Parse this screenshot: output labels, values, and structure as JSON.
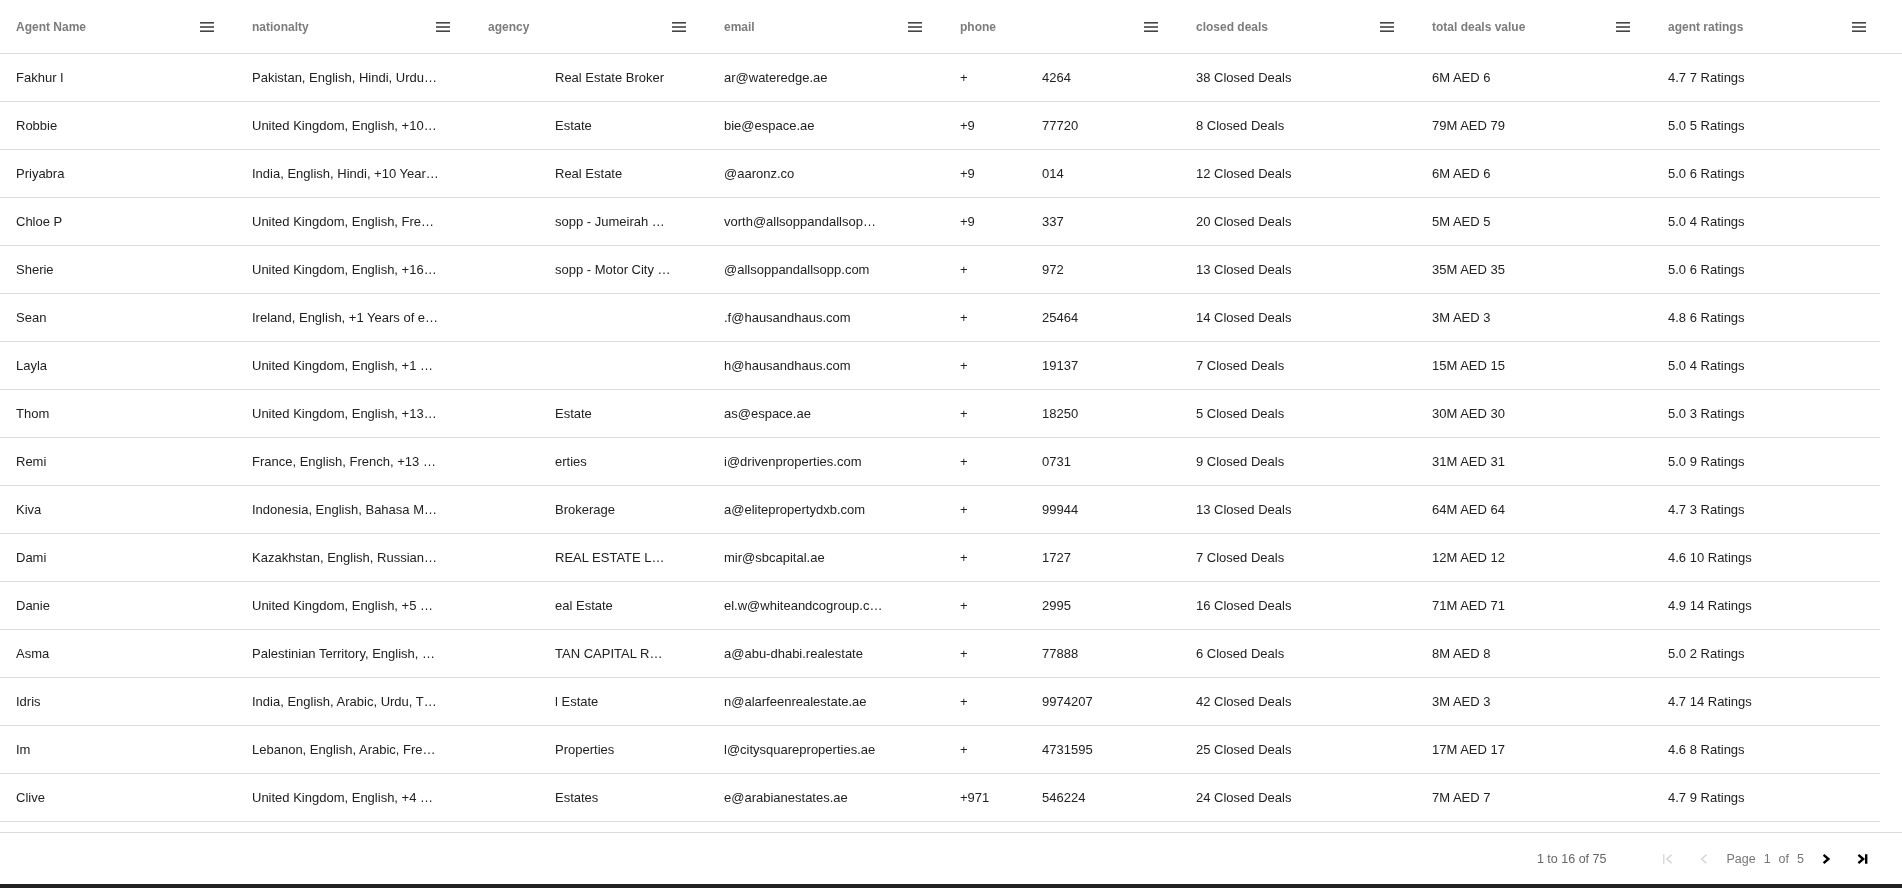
{
  "columns": [
    "Agent Name",
    "nationalty",
    "agency",
    "email",
    "phone",
    "closed deals",
    "total deals value",
    "agent ratings"
  ],
  "rows": [
    {
      "name": "Fakhur I",
      "nationality": "Pakistan, English, Hindi, Urdu…",
      "agency": "Real Estate Broker",
      "email": "ar@wateredge.ae",
      "phone_start": "+",
      "phone_end": "4264",
      "deals": "38 Closed Deals",
      "value": "6M AED 6",
      "rating": "4.7 7 Ratings"
    },
    {
      "name": "Robbie",
      "nationality": "United Kingdom, English, +10…",
      "agency": "Estate",
      "email": "bie@espace.ae",
      "phone_start": "+9",
      "phone_end": "77720",
      "deals": "8 Closed Deals",
      "value": "79M AED 79",
      "rating": "5.0 5 Ratings"
    },
    {
      "name": "Priyabra",
      "nationality": "India, English, Hindi, +10 Year…",
      "agency": "Real Estate",
      "email": "@aaronz.co",
      "phone_start": "+9",
      "phone_end": "014",
      "deals": "12 Closed Deals",
      "value": "6M AED 6",
      "rating": "5.0 6 Ratings"
    },
    {
      "name": "Chloe P",
      "nationality": "United Kingdom, English, Fre…",
      "agency": "sopp - Jumeirah …",
      "email": "vorth@allsoppandallsop…",
      "phone_start": "+9",
      "phone_end": "337",
      "deals": "20 Closed Deals",
      "value": "5M AED 5",
      "rating": "5.0 4 Ratings"
    },
    {
      "name": "Sherie",
      "nationality": "United Kingdom, English, +16…",
      "agency": "sopp - Motor City …",
      "email": "@allsoppandallsopp.com",
      "phone_start": "+",
      "phone_end": "972",
      "deals": "13 Closed Deals",
      "value": "35M AED 35",
      "rating": "5.0 6 Ratings"
    },
    {
      "name": "Sean",
      "nationality": "Ireland, English, +1 Years of e…",
      "email": ".f@hausandhaus.com",
      "phone_start": "+",
      "phone_end": "25464",
      "deals": "14 Closed Deals",
      "value": "3M AED 3",
      "rating": "4.8 6 Ratings"
    },
    {
      "name": "Layla",
      "nationality": "United Kingdom, English, +1 …",
      "email": "h@hausandhaus.com",
      "phone_start": "+",
      "phone_end": "19137",
      "deals": "7 Closed Deals",
      "value": "15M AED 15",
      "rating": "5.0 4 Ratings"
    },
    {
      "name": "Thom",
      "nationality": "United Kingdom, English, +13…",
      "agency": "Estate",
      "email": "as@espace.ae",
      "phone_start": "+",
      "phone_end": "18250",
      "deals": "5 Closed Deals",
      "value": "30M AED 30",
      "rating": "5.0 3 Ratings"
    },
    {
      "name": "Remi",
      "nationality": "France, English, French, +13 …",
      "agency": "erties",
      "email": "i@drivenproperties.com",
      "phone_start": "+",
      "phone_end": "0731",
      "deals": "9 Closed Deals",
      "value": "31M AED 31",
      "rating": "5.0 9 Ratings"
    },
    {
      "name": "Kiva",
      "nationality": "Indonesia, English, Bahasa M…",
      "agency": "Brokerage",
      "email": "a@elitepropertydxb.com",
      "phone_start": "+",
      "phone_end": "99944",
      "deals": "13 Closed Deals",
      "value": "64M AED 64",
      "rating": "4.7 3 Ratings"
    },
    {
      "name": "Dami",
      "nationality": "Kazakhstan, English, Russian…",
      "agency": "REAL ESTATE L…",
      "email": "mir@sbcapital.ae",
      "phone_start": "+",
      "phone_end": "1727",
      "deals": "7 Closed Deals",
      "value": "12M AED 12",
      "rating": "4.6 10 Ratings"
    },
    {
      "name": "Danie",
      "nationality": "United Kingdom, English, +5 …",
      "agency": "eal Estate",
      "email": "el.w@whiteandcogroup.c…",
      "phone_start": "+",
      "phone_end": "2995",
      "deals": "16 Closed Deals",
      "value": "71M AED 71",
      "rating": "4.9 14 Ratings"
    },
    {
      "name": "Asma",
      "nationality": "Palestinian Territory, English, …",
      "agency": "TAN CAPITAL R…",
      "email": "a@abu-dhabi.realestate",
      "phone_start": "+",
      "phone_end": "77888",
      "deals": "6 Closed Deals",
      "value": "8M AED 8",
      "rating": "5.0 2 Ratings"
    },
    {
      "name": "Idris",
      "nationality": "India, English, Arabic, Urdu, T…",
      "agency": "l Estate",
      "email": "n@alarfeenrealestate.ae",
      "phone_start": "+",
      "phone_end": "9974207",
      "deals": "42 Closed Deals",
      "value": "3M AED 3",
      "rating": "4.7 14 Ratings"
    },
    {
      "name": "Im",
      "nationality": "Lebanon, English, Arabic, Fre…",
      "agency": "Properties",
      "email": "l@citysquareproperties.ae",
      "phone_start": "+",
      "phone_end": "4731595",
      "deals": "25 Closed Deals",
      "value": "17M AED 17",
      "rating": "4.6 8 Ratings"
    },
    {
      "name": "Clive",
      "nationality": "United Kingdom, English, +4 …",
      "agency": "Estates",
      "email": "e@arabianestates.ae",
      "phone_start": "+971",
      "phone_end": "546224",
      "deals": "24 Closed Deals",
      "value": "7M AED 7",
      "rating": "4.7 9 Ratings"
    }
  ],
  "pagination": {
    "summary": "1 to 16 of 75",
    "page_label": "Page",
    "page": "1",
    "of_label": "of",
    "total_pages": "5",
    "buttons": [
      {
        "kind": "first",
        "disabled": true
      },
      {
        "kind": "previous",
        "disabled": true
      },
      {
        "kind": "next",
        "disabled": false
      },
      {
        "kind": "last",
        "disabled": false
      }
    ]
  }
}
